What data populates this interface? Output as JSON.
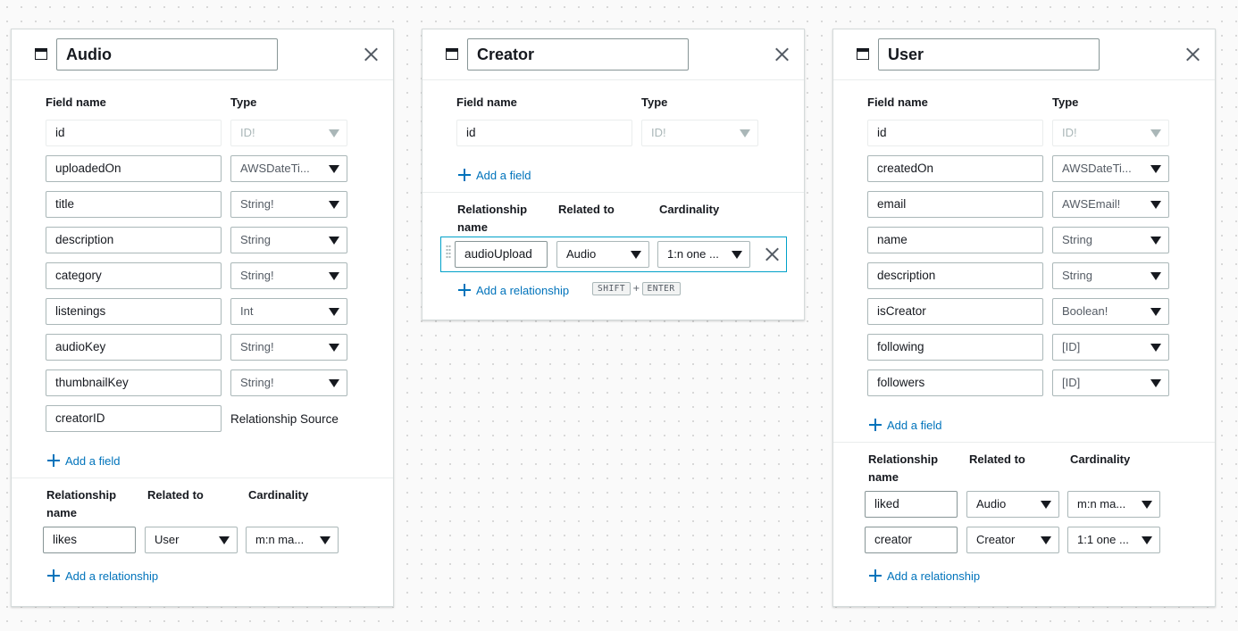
{
  "labels": {
    "field_name": "Field name",
    "type": "Type",
    "add_field": "Add a field",
    "relationship_name": "Relationship name",
    "related_to": "Related to",
    "cardinality": "Cardinality",
    "add_relationship": "Add a relationship",
    "relationship_source": "Relationship Source"
  },
  "models": {
    "audio": {
      "title": "Audio",
      "fields": [
        {
          "name": "id",
          "type": "ID!"
        },
        {
          "name": "uploadedOn",
          "type": "AWSDateTi..."
        },
        {
          "name": "title",
          "type": "String!"
        },
        {
          "name": "description",
          "type": "String"
        },
        {
          "name": "category",
          "type": "String!"
        },
        {
          "name": "listenings",
          "type": "Int"
        },
        {
          "name": "audioKey",
          "type": "String!"
        },
        {
          "name": "thumbnailKey",
          "type": "String!"
        },
        {
          "name": "creatorID",
          "type": ""
        }
      ],
      "relationships": [
        {
          "name": "likes",
          "related_to": "User",
          "cardinality": "m:n ma..."
        }
      ]
    },
    "creator": {
      "title": "Creator",
      "fields": [
        {
          "name": "id",
          "type": "ID!"
        }
      ],
      "relationships": [
        {
          "name": "audioUpload",
          "related_to": "Audio",
          "cardinality": "1:n one ..."
        }
      ],
      "shortcut": {
        "key1": "SHIFT",
        "plus": "+",
        "key2": "ENTER"
      }
    },
    "user": {
      "title": "User",
      "fields": [
        {
          "name": "id",
          "type": "ID!"
        },
        {
          "name": "createdOn",
          "type": "AWSDateTi..."
        },
        {
          "name": "email",
          "type": "AWSEmail!"
        },
        {
          "name": "name",
          "type": "String"
        },
        {
          "name": "description",
          "type": "String"
        },
        {
          "name": "isCreator",
          "type": "Boolean!"
        },
        {
          "name": "following",
          "type": "[ID]"
        },
        {
          "name": "followers",
          "type": "[ID]"
        }
      ],
      "relationships": [
        {
          "name": "liked",
          "related_to": "Audio",
          "cardinality": "m:n ma..."
        },
        {
          "name": "creator",
          "related_to": "Creator",
          "cardinality": "1:1 one ..."
        }
      ]
    }
  }
}
